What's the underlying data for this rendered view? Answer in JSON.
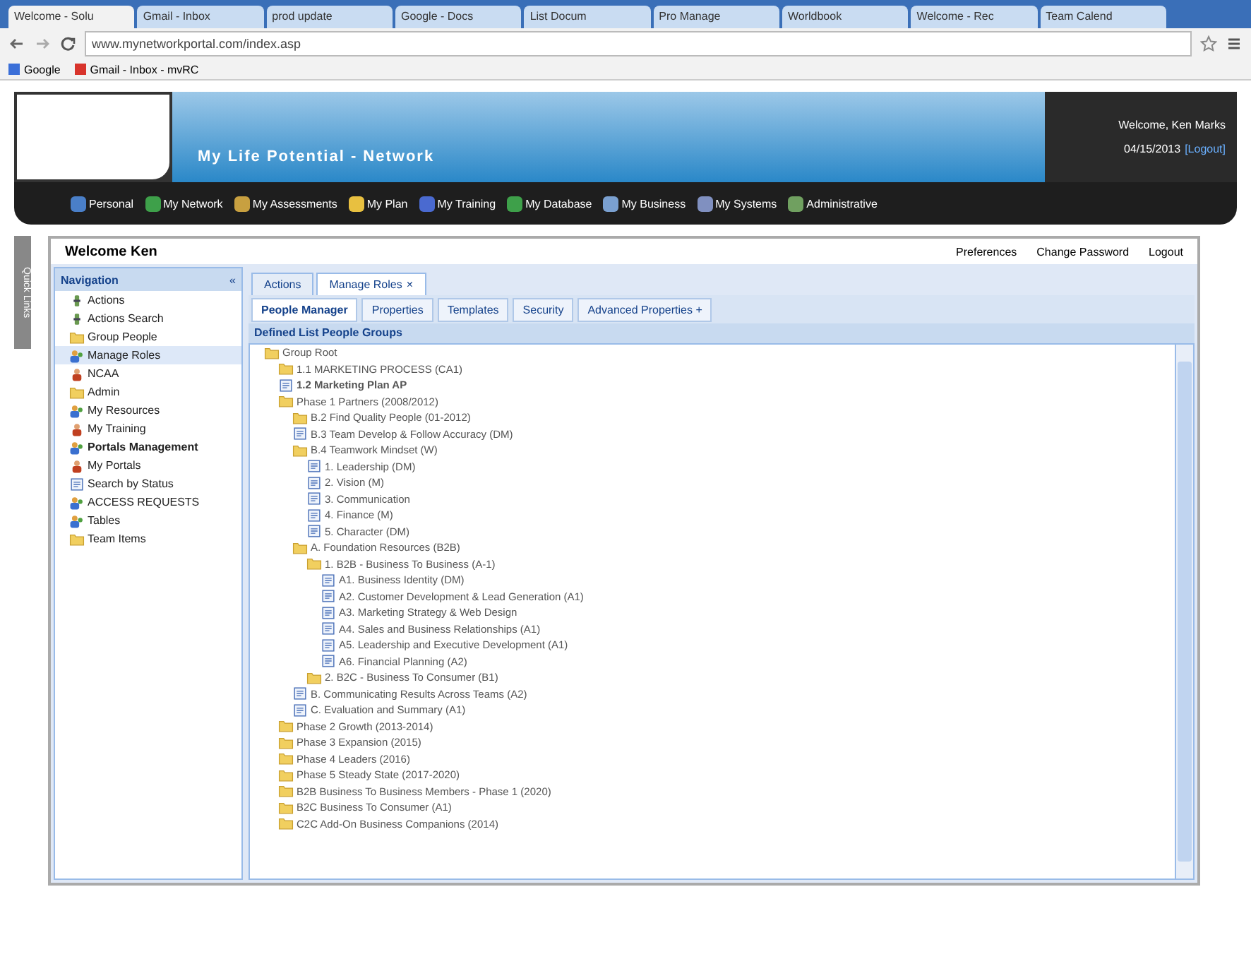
{
  "browser": {
    "tabs": [
      {
        "title": "Welcome - Solu",
        "selected": true
      },
      {
        "title": "Gmail - Inbox",
        "selected": false
      },
      {
        "title": "prod update",
        "selected": false
      },
      {
        "title": "Google - Docs",
        "selected": false
      },
      {
        "title": "List Docum",
        "selected": false
      },
      {
        "title": "Pro Manage",
        "selected": false
      },
      {
        "title": "Worldbook",
        "selected": false
      },
      {
        "title": "Welcome - Rec",
        "selected": false
      },
      {
        "title": "Team Calend",
        "selected": false
      }
    ],
    "url": "www.mynetworkportal.com/index.asp",
    "bookmarks": [
      {
        "label": "Google",
        "color": "#3b6fd8"
      },
      {
        "label": "Gmail - Inbox - mvRC",
        "color": "#d8342c"
      }
    ]
  },
  "header": {
    "title": "My Life Potential - Network",
    "welcome": "Welcome, Ken Marks",
    "date": "04/15/2013",
    "logout": "[Logout]"
  },
  "menu": [
    {
      "label": "Personal",
      "color": "#4a7fc8"
    },
    {
      "label": "My Network",
      "color": "#3ea04a"
    },
    {
      "label": "My Assessments",
      "color": "#c8a040"
    },
    {
      "label": "My Plan",
      "color": "#e8c040"
    },
    {
      "label": "My Training",
      "color": "#4a6ad0"
    },
    {
      "label": "My Database",
      "color": "#3ea04a"
    },
    {
      "label": "My Business",
      "color": "#7aa0d0"
    },
    {
      "label": "My Systems",
      "color": "#8090c0"
    },
    {
      "label": "Administrative",
      "color": "#70a060"
    }
  ],
  "side_tab": "Quick Links",
  "panel": {
    "title": "Welcome Ken",
    "links": [
      "Preferences",
      "Change Password",
      "Logout"
    ]
  },
  "navigation": {
    "title": "Navigation",
    "collapse": "«",
    "items": [
      {
        "label": "Actions",
        "kind": "tool",
        "selected": false,
        "bold": false
      },
      {
        "label": "Actions Search",
        "kind": "tool",
        "selected": false,
        "bold": false
      },
      {
        "label": "Group People",
        "kind": "folder",
        "selected": false,
        "bold": false
      },
      {
        "label": "Manage Roles",
        "kind": "people",
        "selected": true,
        "bold": false
      },
      {
        "label": "NCAA",
        "kind": "person",
        "selected": false,
        "bold": false
      },
      {
        "label": "Admin",
        "kind": "folder",
        "selected": false,
        "bold": false
      },
      {
        "label": "My Resources",
        "kind": "people",
        "selected": false,
        "bold": false
      },
      {
        "label": "My Training",
        "kind": "person",
        "selected": false,
        "bold": false
      },
      {
        "label": "Portals Management",
        "kind": "people",
        "selected": false,
        "bold": true
      },
      {
        "label": "My Portals",
        "kind": "person",
        "selected": false,
        "bold": false
      },
      {
        "label": "Search by Status",
        "kind": "doc",
        "selected": false,
        "bold": false
      },
      {
        "label": "ACCESS REQUESTS",
        "kind": "people",
        "selected": false,
        "bold": false
      },
      {
        "label": "Tables",
        "kind": "people",
        "selected": false,
        "bold": false
      },
      {
        "label": "Team Items",
        "kind": "folder",
        "selected": false,
        "bold": false
      }
    ]
  },
  "tabs": [
    {
      "label": "Actions",
      "selected": false
    },
    {
      "label": "Manage Roles",
      "selected": true,
      "close": "×"
    }
  ],
  "subtabs": [
    {
      "label": "People Manager",
      "selected": true
    },
    {
      "label": "Properties",
      "selected": false
    },
    {
      "label": "Templates",
      "selected": false
    },
    {
      "label": "Security",
      "selected": false
    },
    {
      "label": "Advanced Properties +",
      "selected": false
    }
  ],
  "tree_title": "Defined List People Groups",
  "tree": [
    {
      "label": "Group Root",
      "kind": "folder",
      "bold": false,
      "children": [
        {
          "label": "1.1 MARKETING PROCESS (CA1)",
          "kind": "folder",
          "bold": false
        },
        {
          "label": "1.2 Marketing Plan AP",
          "kind": "doc",
          "bold": true
        },
        {
          "label": "Phase 1 Partners (2008/2012)",
          "kind": "folder",
          "bold": false,
          "children": [
            {
              "label": "B.2 Find Quality People (01-2012)",
              "kind": "folder",
              "bold": false
            },
            {
              "label": "B.3 Team Develop & Follow Accuracy (DM)",
              "kind": "doc",
              "bold": false
            },
            {
              "label": "B.4 Teamwork Mindset (W)",
              "kind": "folder",
              "bold": false,
              "children": [
                {
                  "label": "1. Leadership (DM)",
                  "kind": "doc",
                  "bold": false
                },
                {
                  "label": "2. Vision (M)",
                  "kind": "doc",
                  "bold": false
                },
                {
                  "label": "3. Communication",
                  "kind": "doc",
                  "bold": false
                },
                {
                  "label": "4. Finance (M)",
                  "kind": "doc",
                  "bold": false
                },
                {
                  "label": "5. Character (DM)",
                  "kind": "doc",
                  "bold": false
                }
              ]
            },
            {
              "label": "A. Foundation Resources (B2B)",
              "kind": "folder",
              "bold": false,
              "children": [
                {
                  "label": "1. B2B - Business To Business (A-1)",
                  "kind": "folder",
                  "bold": false,
                  "children": [
                    {
                      "label": "A1. Business Identity (DM)",
                      "kind": "doc",
                      "bold": false
                    },
                    {
                      "label": "A2. Customer Development & Lead Generation (A1)",
                      "kind": "doc",
                      "bold": false
                    },
                    {
                      "label": "A3. Marketing Strategy & Web Design",
                      "kind": "doc",
                      "bold": false
                    },
                    {
                      "label": "A4. Sales and Business Relationships (A1)",
                      "kind": "doc",
                      "bold": false
                    },
                    {
                      "label": "A5. Leadership and Executive Development (A1)",
                      "kind": "doc",
                      "bold": false
                    },
                    {
                      "label": "A6. Financial Planning (A2)",
                      "kind": "doc",
                      "bold": false
                    }
                  ]
                },
                {
                  "label": "2. B2C - Business To Consumer (B1)",
                  "kind": "folder",
                  "bold": false
                }
              ]
            },
            {
              "label": "B. Communicating Results Across Teams (A2)",
              "kind": "doc",
              "bold": false
            },
            {
              "label": "C. Evaluation and Summary (A1)",
              "kind": "doc",
              "bold": false
            }
          ]
        },
        {
          "label": "Phase 2 Growth (2013-2014)",
          "kind": "folder",
          "bold": false
        },
        {
          "label": "Phase 3 Expansion (2015)",
          "kind": "folder",
          "bold": false
        },
        {
          "label": "Phase 4 Leaders (2016)",
          "kind": "folder",
          "bold": false
        },
        {
          "label": "Phase 5 Steady State (2017-2020)",
          "kind": "folder",
          "bold": false
        },
        {
          "label": "B2B Business To Business Members - Phase 1 (2020)",
          "kind": "folder",
          "bold": false
        },
        {
          "label": "B2C Business To Consumer (A1)",
          "kind": "folder",
          "bold": false
        },
        {
          "label": "C2C Add-On Business Companions (2014)",
          "kind": "folder",
          "bold": false
        }
      ]
    }
  ]
}
